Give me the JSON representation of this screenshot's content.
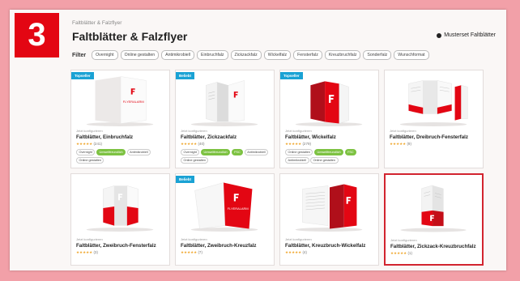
{
  "step_number": "3",
  "breadcrumb": "Faltblätter & Falzflyer",
  "page_title": "Faltblätter & Falzflyer",
  "muster_label": "Musterset Faltblätter",
  "filter": {
    "label": "Filter",
    "chips": [
      "Overnight",
      "Online gestalten",
      "Antimikrobiell",
      "Einbruchfalz",
      "Zickzackfalz",
      "Wickelfalz",
      "Fensterfalz",
      "Kreuzbruchfalz",
      "Sonderfalz",
      "Wunschformat"
    ]
  },
  "brand_color": "#e30613",
  "cards": [
    {
      "badge": "Topseller",
      "sub": "Jetzt konfigurieren",
      "name": "Faltblätter, Einbruchfalz",
      "rating": "★★★★★",
      "count": "(241)",
      "tags": [
        {
          "t": "Overnight",
          "g": false
        },
        {
          "t": "Umweltfreundlich",
          "g": true
        },
        {
          "t": "Antimikrobiell",
          "g": false
        },
        {
          "t": "Online gestalten",
          "g": false
        }
      ],
      "product": "flat"
    },
    {
      "badge": "Beliebt",
      "sub": "Jetzt konfigurieren",
      "name": "Faltblätter, Zickzackfalz",
      "rating": "★★★★★",
      "count": "(40)",
      "tags": [
        {
          "t": "Overnight",
          "g": false
        },
        {
          "t": "Umweltfreundlich",
          "g": true
        },
        {
          "t": "FSC",
          "g": true
        },
        {
          "t": "Antimikrobiell",
          "g": false
        },
        {
          "t": "Online gestalten",
          "g": false
        }
      ],
      "product": "zigzag"
    },
    {
      "badge": "Topseller",
      "sub": "Jetzt konfigurieren",
      "name": "Faltblätter, Wickelfalz",
      "rating": "★★★★★",
      "count": "(279)",
      "tags": [
        {
          "t": "Online gestalten",
          "g": false
        },
        {
          "t": "Umweltfreundlich",
          "g": true
        },
        {
          "t": "FSC",
          "g": true
        },
        {
          "t": "Antimikrobiell",
          "g": false
        },
        {
          "t": "Online gestalten",
          "g": false
        }
      ],
      "product": "wrap"
    },
    {
      "badge": "",
      "sub": "Jetzt konfigurieren",
      "name": "Faltblätter, Dreibruch-Fensterfalz",
      "rating": "★★★★★",
      "count": "(9)",
      "tags": [],
      "product": "window"
    },
    {
      "badge": "",
      "sub": "Jetzt konfigurieren",
      "name": "Faltblätter, Zweibruch-Fensterfalz",
      "rating": "★★★★★",
      "count": "(3)",
      "tags": [],
      "product": "window2"
    },
    {
      "badge": "Beliebt",
      "sub": "Jetzt konfigurieren",
      "name": "Faltblätter, Zweibruch-Kreuzfalz",
      "rating": "★★★★★",
      "count": "(7)",
      "tags": [],
      "product": "cross"
    },
    {
      "badge": "",
      "sub": "Jetzt konfigurieren",
      "name": "Faltblätter, Kreuzbruch-Wickelfalz",
      "rating": "★★★★★",
      "count": "(4)",
      "tags": [],
      "product": "crosswrap"
    },
    {
      "badge": "",
      "sub": "Jetzt konfigurieren",
      "name": "Faltblätter, Zickzack-Kreuzbruchfalz",
      "rating": "★★★★★",
      "count": "(1)",
      "tags": [],
      "product": "zigcross",
      "selected": true
    }
  ],
  "brand_text": "FLYERALARM"
}
